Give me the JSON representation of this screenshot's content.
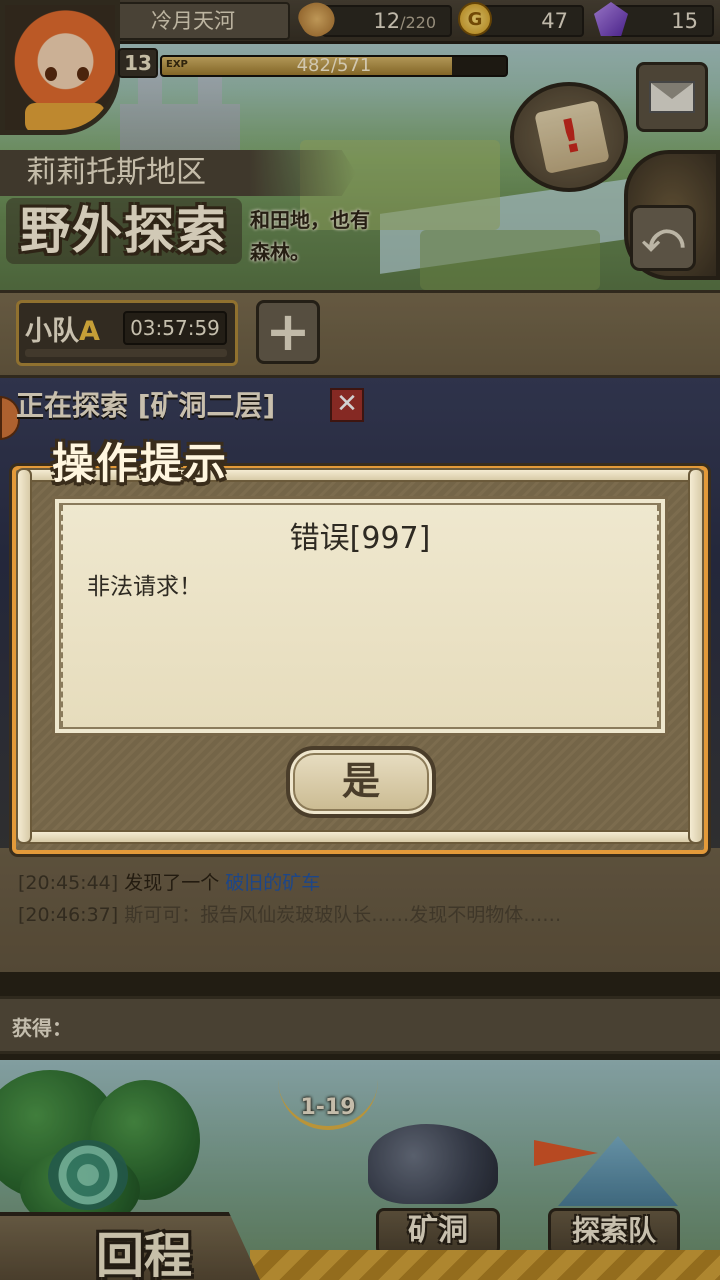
{
  "player": {
    "name": "冷月天河",
    "level": "13",
    "exp_label": "EXP",
    "exp_text": "482/571",
    "exp_fraction": 0.844
  },
  "resources": {
    "stamina_value": "12",
    "stamina_max": "/220",
    "gold": "47",
    "gems": "15",
    "gold_icon_glyph": "G"
  },
  "region": {
    "name": "莉莉托斯地区",
    "desc_line1": "和田地，也有",
    "desc_line2": "森林。",
    "mode_title": "野外探索"
  },
  "squad": {
    "name_prefix": "小队",
    "name_letter": "A",
    "timer": "03:57:59",
    "add_glyph": "+"
  },
  "exploration": {
    "status_text": "正在探索 [矿洞二层]",
    "close_glyph": "✕"
  },
  "log": [
    {
      "time": "[20:45:44]",
      "text": " 发现了一个 ",
      "link": "破旧的矿车"
    },
    {
      "time": "[20:46:37]",
      "text": " 斯可可：报告风仙炭玻玻队长……发现不明物体……",
      "link": ""
    }
  ],
  "obtained": {
    "label": "获得："
  },
  "bottom_nav": {
    "stage": "1-19",
    "mine_label": "矿洞",
    "team_label": "探索队",
    "return_label": "回程"
  },
  "buttons": {
    "back_glyph": "⤺"
  },
  "modal": {
    "title": "操作提示",
    "heading": "错误[997]",
    "message": "非法请求！",
    "ok_label": "是"
  },
  "colors": {
    "accent_orange": "#e39a3a",
    "link_blue": "#2456a6",
    "gold": "#d29a1c"
  }
}
